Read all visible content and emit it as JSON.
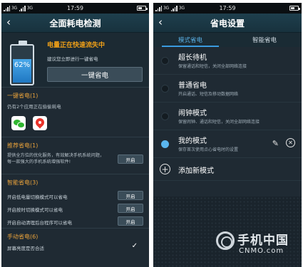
{
  "status_bar": {
    "signal_label_1": "3G",
    "signal_label_2": "3G",
    "time": "17:59"
  },
  "left_screen": {
    "title": "全面耗电检测",
    "battery": {
      "percent_text": "62%",
      "level": 0.62,
      "fill_color": "#2f8fd8"
    },
    "warning": "电量正在快速流失中",
    "suggest": "建议您立即进行一键省电",
    "one_key_button": "一键省电",
    "sections": {
      "one_key": {
        "title": "一键省电(1)",
        "subtitle": "仍有2个应用正在偷偷耗电",
        "apps": [
          {
            "name": "wechat-icon"
          },
          {
            "name": "map-icon"
          }
        ]
      },
      "recommend": {
        "title": "推荐省电(1)",
        "desc": "提供全方位的优化服务，有效解决手机系统问题，每一款强大的手机系统增强软件!",
        "button": "开启"
      },
      "smart": {
        "title": "智能省电(3)",
        "rows": [
          {
            "label": "开启低电量切换模式可以省电",
            "button": "开启"
          },
          {
            "label": "开启按时切换模式可以省电",
            "button": "开启"
          },
          {
            "label": "开启自动清理后台程序可以省电",
            "button": "开启"
          }
        ]
      },
      "manual": {
        "title": "手动省电(6)",
        "row_label": "屏幕亮度是否合适",
        "check": "✓"
      }
    }
  },
  "right_screen": {
    "title": "省电设置",
    "tabs": [
      {
        "label": "模式省电",
        "active": true
      },
      {
        "label": "智能省电",
        "active": false
      }
    ],
    "modes": [
      {
        "name": "超长待机",
        "desc": "保留通话和短信，关闭全部网络连接",
        "selected": false
      },
      {
        "name": "普通省电",
        "desc": "开启通话、短信及移动数据网络",
        "selected": false
      },
      {
        "name": "闹钟模式",
        "desc": "保留闹钟、通话和短信，关闭全部网络连接",
        "selected": false
      },
      {
        "name": "我的模式",
        "desc": "保存首次使用点心省电时的设置",
        "selected": true
      }
    ],
    "add_mode": "添加新模式",
    "accent_color": "#5ab6ee"
  },
  "watermark": {
    "cn": "手机中国",
    "en": "CNMO.com"
  }
}
